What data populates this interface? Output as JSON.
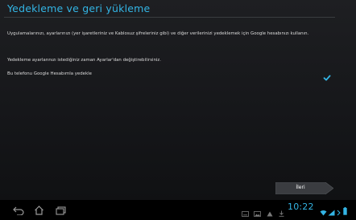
{
  "setup": {
    "title": "Yedekleme ve geri yükleme",
    "description": "Uygulamalarınızı, ayarlarınızı (yer işaretleriniz ve Kablosuz şifreleriniz gibi) ve diğer verilerinizi yedeklemek için Google hesabınızı kullanın.",
    "note": "Yedekleme ayarlarınızı istediğiniz zaman Ayarlar'dan değiştirebilirsiniz.",
    "backup_option": {
      "label": "Bu telefonu Google Hesabımla yedekle",
      "checked": true
    },
    "next_label": "İleri",
    "accent_color": "#33b5e5"
  },
  "navbar": {
    "buttons": [
      "back-icon",
      "home-icon",
      "recent-apps-icon"
    ],
    "status_icons": [
      "keyboard-icon",
      "image-icon",
      "alert-icon",
      "download-icon",
      "wifi-icon",
      "signal-icon",
      "battery-icon"
    ],
    "clock": "10:22"
  }
}
